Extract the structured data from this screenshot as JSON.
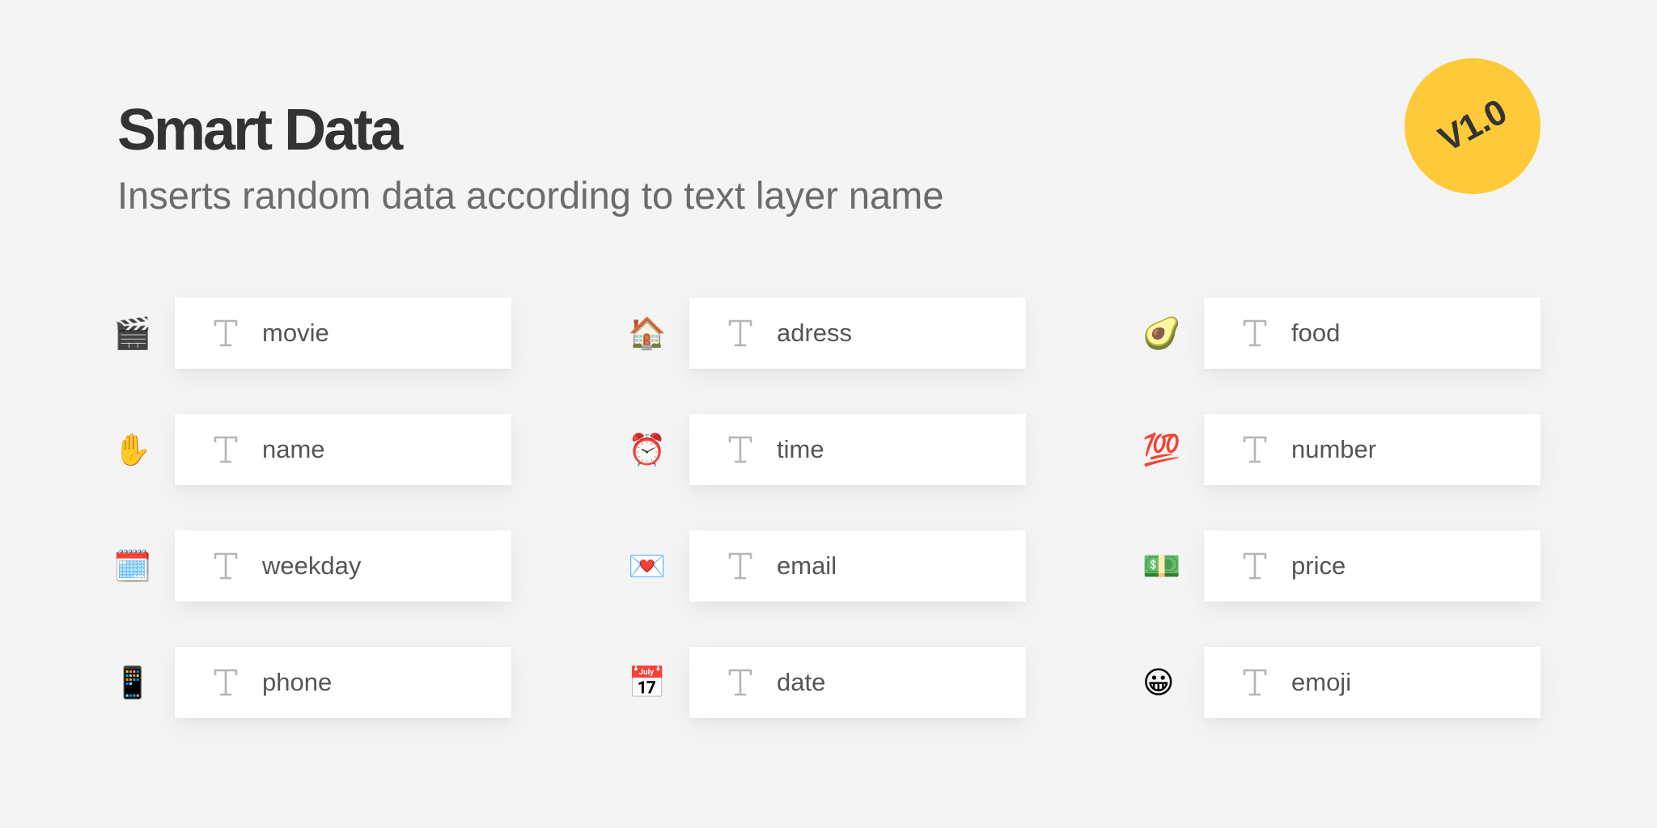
{
  "header": {
    "title": "Smart Data",
    "subtitle": "Inserts random data according to text layer name"
  },
  "badge": {
    "label": "V1.0",
    "color": "#ffca3a"
  },
  "layers": [
    {
      "emoji": "🎬",
      "emoji_name": "clapper-board-icon",
      "name": "movie"
    },
    {
      "emoji": "🏠",
      "emoji_name": "house-icon",
      "name": "adress"
    },
    {
      "emoji": "🥑",
      "emoji_name": "avocado-icon",
      "name": "food"
    },
    {
      "emoji": "✋",
      "emoji_name": "raised-hand-icon",
      "name": "name"
    },
    {
      "emoji": "⏰",
      "emoji_name": "alarm-clock-icon",
      "name": "time"
    },
    {
      "emoji": "💯",
      "emoji_name": "hundred-points-icon",
      "name": "number"
    },
    {
      "emoji": "🗓️",
      "emoji_name": "spiral-calendar-icon",
      "name": "weekday"
    },
    {
      "emoji": "💌",
      "emoji_name": "love-letter-icon",
      "name": "email"
    },
    {
      "emoji": "💵",
      "emoji_name": "dollar-banknote-icon",
      "name": "price"
    },
    {
      "emoji": "📱",
      "emoji_name": "mobile-phone-icon",
      "name": "phone"
    },
    {
      "emoji": "📅",
      "emoji_name": "calendar-icon",
      "name": "date"
    },
    {
      "emoji": "😀",
      "emoji_name": "grinning-face-icon",
      "name": "emoji"
    }
  ],
  "text_layer_icon": "text-layer-icon"
}
